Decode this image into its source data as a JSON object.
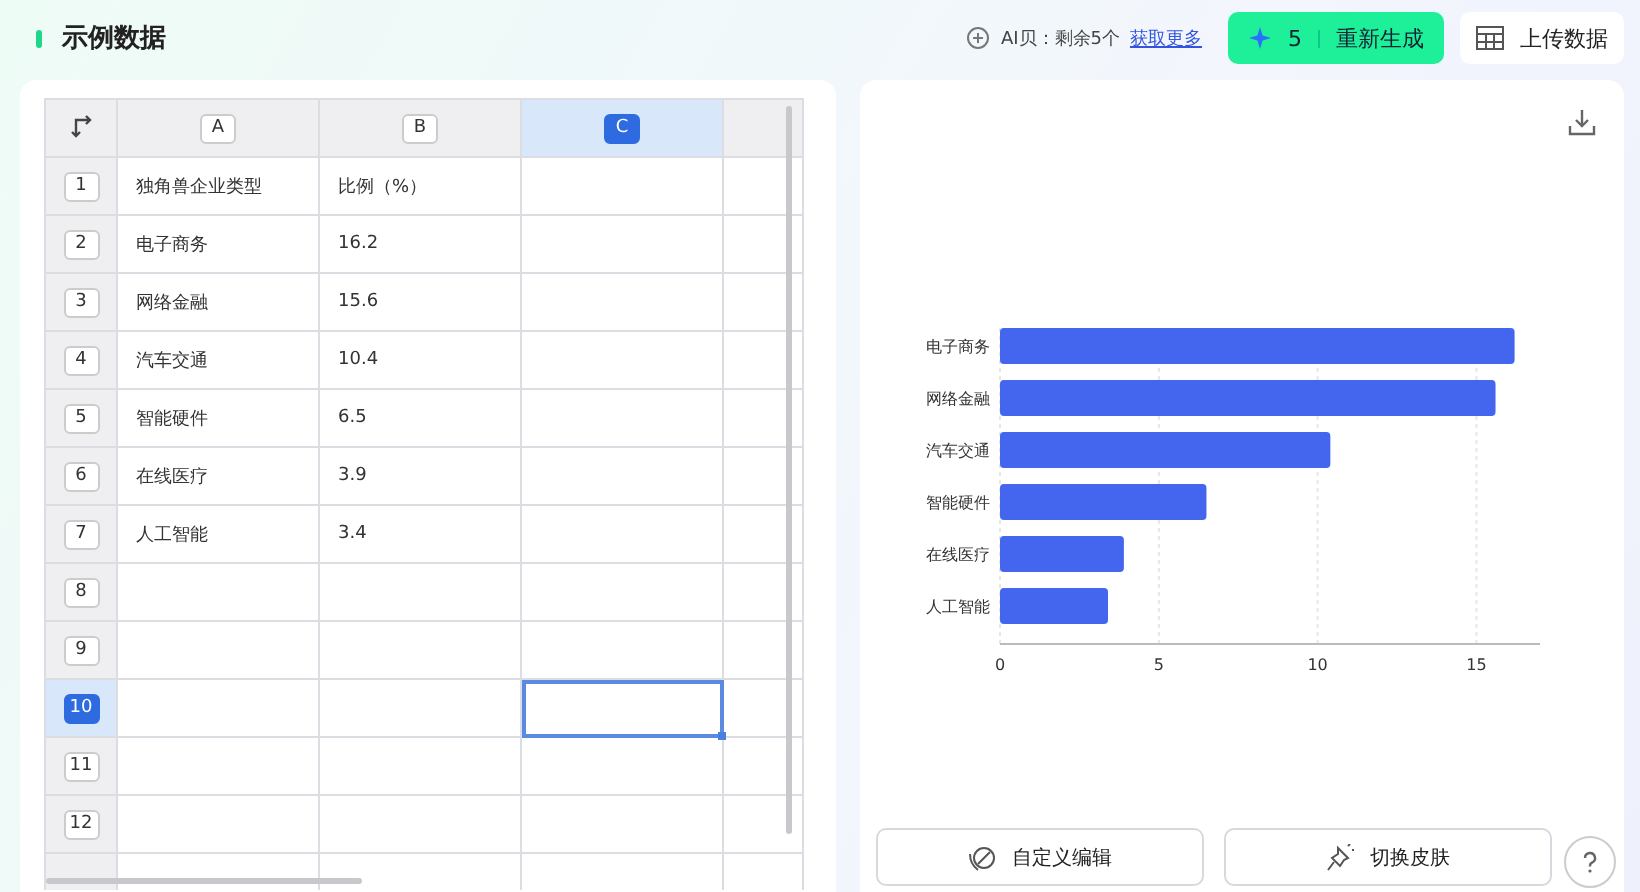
{
  "header": {
    "title": "示例数据",
    "quota_label": "AI贝：剩余5个",
    "quota_link": "获取更多",
    "regenerate": {
      "count": "5",
      "label": "重新生成"
    },
    "upload": "上传数据"
  },
  "table": {
    "columns": [
      {
        "label": "A",
        "selected": false
      },
      {
        "label": "B",
        "selected": false
      },
      {
        "label": "C",
        "selected": true
      }
    ],
    "rows": [
      {
        "number": "1",
        "selected": false,
        "cells": [
          "独角兽企业类型",
          "比例（%）",
          ""
        ]
      },
      {
        "number": "2",
        "selected": false,
        "cells": [
          "电子商务",
          "16.2",
          ""
        ]
      },
      {
        "number": "3",
        "selected": false,
        "cells": [
          "网络金融",
          "15.6",
          ""
        ]
      },
      {
        "number": "4",
        "selected": false,
        "cells": [
          "汽车交通",
          "10.4",
          ""
        ]
      },
      {
        "number": "5",
        "selected": false,
        "cells": [
          "智能硬件",
          "6.5",
          ""
        ]
      },
      {
        "number": "6",
        "selected": false,
        "cells": [
          "在线医疗",
          "3.9",
          ""
        ]
      },
      {
        "number": "7",
        "selected": false,
        "cells": [
          "人工智能",
          "3.4",
          ""
        ]
      },
      {
        "number": "8",
        "selected": false,
        "cells": [
          "",
          "",
          ""
        ]
      },
      {
        "number": "9",
        "selected": false,
        "cells": [
          "",
          "",
          ""
        ]
      },
      {
        "number": "10",
        "selected": true,
        "cells": [
          "",
          "",
          ""
        ]
      },
      {
        "number": "11",
        "selected": false,
        "cells": [
          "",
          "",
          ""
        ]
      },
      {
        "number": "12",
        "selected": false,
        "cells": [
          "",
          "",
          ""
        ]
      }
    ]
  },
  "chart": {
    "chart_data": {
      "type": "bar",
      "orientation": "horizontal",
      "categories": [
        "电子商务",
        "网络金融",
        "汽车交通",
        "智能硬件",
        "在线医疗",
        "人工智能"
      ],
      "series": [
        {
          "color": "#4466ee",
          "values": [
            16.2,
            15.6,
            10.4,
            6.5,
            3.9,
            3.4
          ]
        }
      ],
      "xlim": [
        0,
        17
      ],
      "xticks": [
        0,
        5,
        10,
        15
      ],
      "grid": true
    }
  },
  "buttons": [
    {
      "kind": "edit",
      "label": "自定义编辑"
    },
    {
      "kind": "skin",
      "label": "切换皮肤"
    }
  ]
}
